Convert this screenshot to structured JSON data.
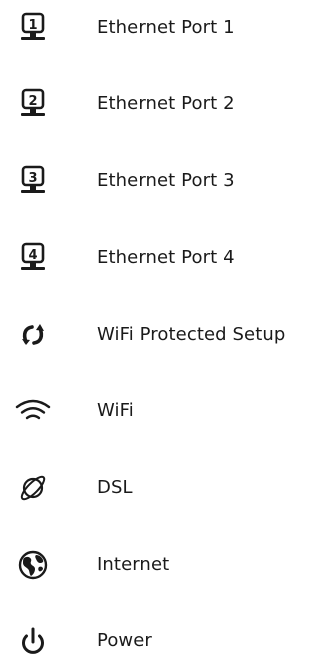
{
  "legend": {
    "items": [
      {
        "icon": "ethernet-port-1-icon",
        "label": "Ethernet Port 1"
      },
      {
        "icon": "ethernet-port-2-icon",
        "label": "Ethernet Port 2"
      },
      {
        "icon": "ethernet-port-3-icon",
        "label": "Ethernet Port 3"
      },
      {
        "icon": "ethernet-port-4-icon",
        "label": "Ethernet Port 4"
      },
      {
        "icon": "wps-icon",
        "label": "WiFi Protected Setup"
      },
      {
        "icon": "wifi-icon",
        "label": "WiFi"
      },
      {
        "icon": "dsl-icon",
        "label": "DSL"
      },
      {
        "icon": "internet-globe-icon",
        "label": "Internet"
      },
      {
        "icon": "power-icon",
        "label": "Power"
      }
    ],
    "port_numbers": [
      "1",
      "2",
      "3",
      "4"
    ],
    "icon_color": "#1a1a1a",
    "text_color": "#1a1a1a"
  }
}
